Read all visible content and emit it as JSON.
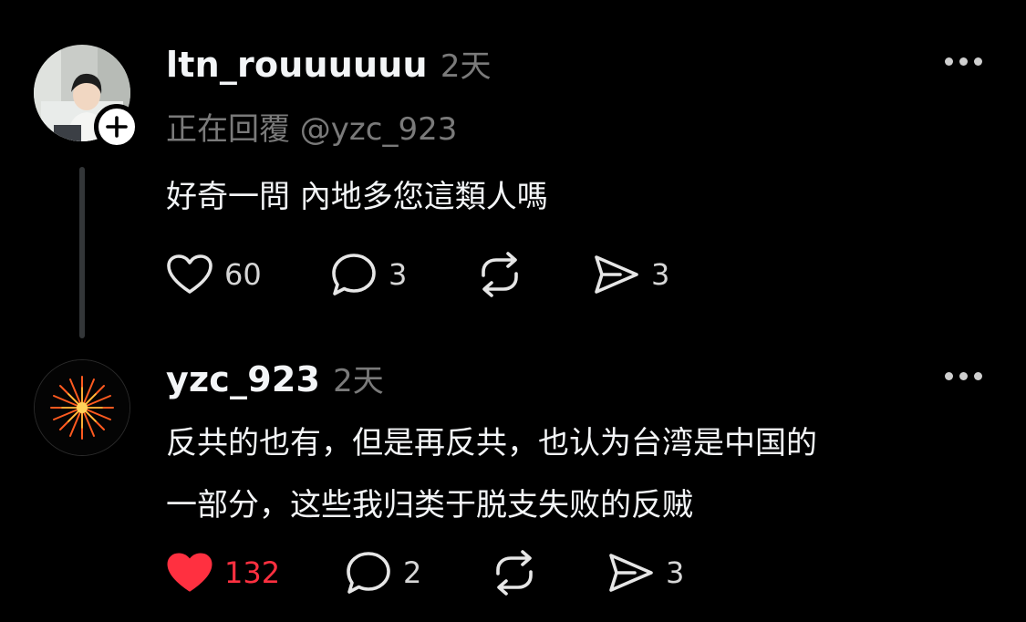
{
  "posts": [
    {
      "username": "ltn_rouuuuuu",
      "time": "2天",
      "reply_to": "正在回覆 @yzc_923",
      "lines": [
        "好奇一問 內地多您這類人嗎"
      ],
      "actions": {
        "likes": "60",
        "comments": "3",
        "reposts": "",
        "shares": "3"
      },
      "liked": false
    },
    {
      "username": "yzc_923",
      "time": "2天",
      "lines": [
        "反共的也有，但是再反共，也认为台湾是中国的",
        "一部分，这些我归类于脱支失败的反贼"
      ],
      "actions": {
        "likes": "132",
        "comments": "2",
        "reposts": "",
        "shares": "3"
      },
      "liked": true
    }
  ],
  "colors": {
    "background": "#000000",
    "text": "#f3f5f7",
    "muted": "#7a7a7a",
    "liked": "#ff3040"
  },
  "icons": [
    "heart-icon",
    "comment-icon",
    "repost-icon",
    "share-icon",
    "more-icon",
    "plus-icon"
  ]
}
